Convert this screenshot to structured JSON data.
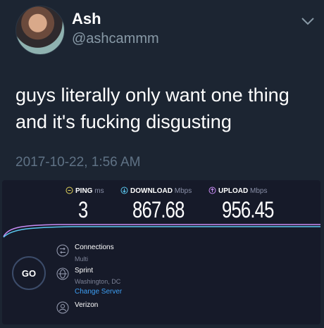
{
  "tweet": {
    "name": "Ash",
    "handle": "@ashcammm",
    "text": "guys literally only want one thing and it's fucking disgusting",
    "timestamp": "2017-10-22, 1:56 AM",
    "menu_icon": "chevron-down-icon"
  },
  "speedtest": {
    "ping": {
      "label": "PING",
      "unit": "ms",
      "value": "3"
    },
    "download": {
      "label": "DOWNLOAD",
      "unit": "Mbps",
      "value": "867.68"
    },
    "upload": {
      "label": "UPLOAD",
      "unit": "Mbps",
      "value": "956.45"
    },
    "go_label": "GO",
    "connections": {
      "label": "Connections",
      "value": "Multi"
    },
    "server": {
      "label": "Sprint",
      "location": "Washington, DC",
      "change_label": "Change Server"
    },
    "isp": {
      "label": "Verizon"
    },
    "colors": {
      "download": "#5bc8f0",
      "upload": "#c98df5",
      "link": "#3d9ef3",
      "background": "#161a29"
    }
  }
}
